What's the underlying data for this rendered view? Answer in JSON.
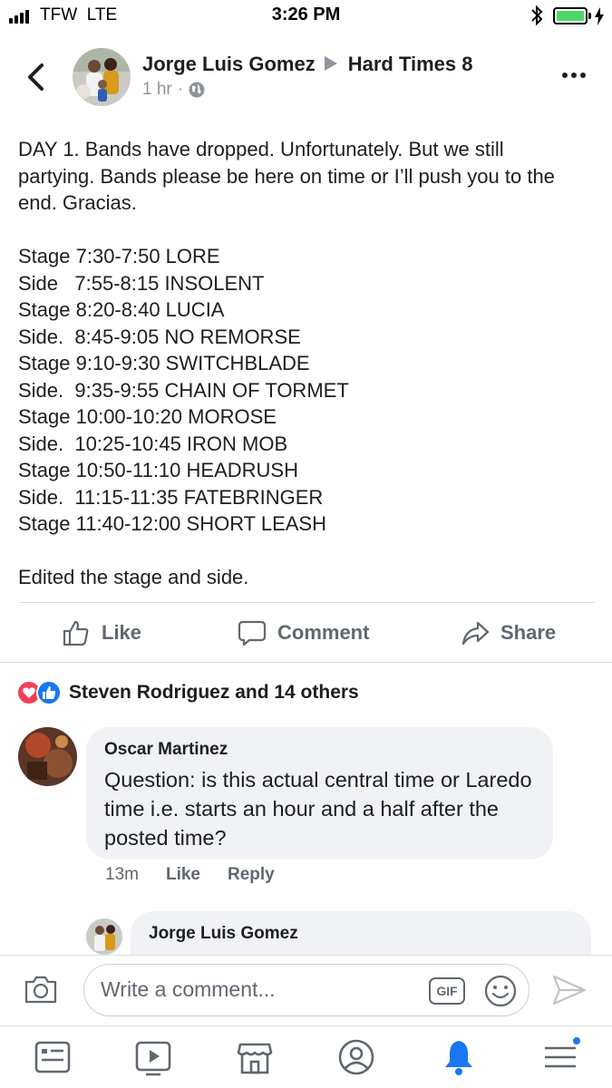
{
  "status_bar": {
    "carrier": "TFW  LTE",
    "time": "3:26 PM",
    "battery_level": 1.0,
    "icons": [
      "signal-icon",
      "bluetooth-icon",
      "battery-icon",
      "charging-icon"
    ]
  },
  "post": {
    "author": "Jorge Luis Gomez",
    "group": "Hard Times 8",
    "time_ago": "1 hr",
    "separator": "·",
    "privacy_icon": "globe-icon",
    "intro": "DAY 1. Bands have dropped. Unfortunately. But we still partying. Bands please be here on time or I’ll push you to the end. Gracias.",
    "schedule": [
      "Stage 7:30-7:50 LORE",
      "Side   7:55-8:15 INSOLENT",
      "Stage 8:20-8:40 LUCIA",
      "Side.  8:45-9:05 NO REMORSE",
      "Stage 9:10-9:30 SWITCHBLADE",
      "Side.  9:35-9:55 CHAIN OF TORMET",
      "Stage 10:00-10:20 MOROSE",
      "Side.  10:25-10:45 IRON MOB",
      "Stage 10:50-11:10 HEADRUSH",
      "Side.  11:15-11:35 FATEBRINGER",
      "Stage 11:40-12:00 SHORT LEASH"
    ],
    "footer": "Edited the stage and side."
  },
  "actions": {
    "like": "Like",
    "comment": "Comment",
    "share": "Share"
  },
  "reactions": {
    "summary": "Steven Rodriguez and 14 others",
    "types": [
      "love",
      "like"
    ],
    "colors": {
      "love": "#f33e58",
      "like": "#1877f2"
    }
  },
  "comments": [
    {
      "author": "Oscar Martinez",
      "text": "Question: is this actual central time or Laredo time i.e. starts an hour and a half after the posted time?",
      "time": "13m",
      "like": "Like",
      "reply": "Reply"
    }
  ],
  "reply": {
    "author": "Jorge Luis Gomez"
  },
  "composer": {
    "placeholder": "Write a comment...",
    "gif": "GIF"
  },
  "tab_bar": {
    "tabs": [
      "news-feed-icon",
      "watch-icon",
      "marketplace-icon",
      "profile-icon",
      "notifications-icon",
      "menu-icon"
    ],
    "active_color": "#1877f2"
  }
}
